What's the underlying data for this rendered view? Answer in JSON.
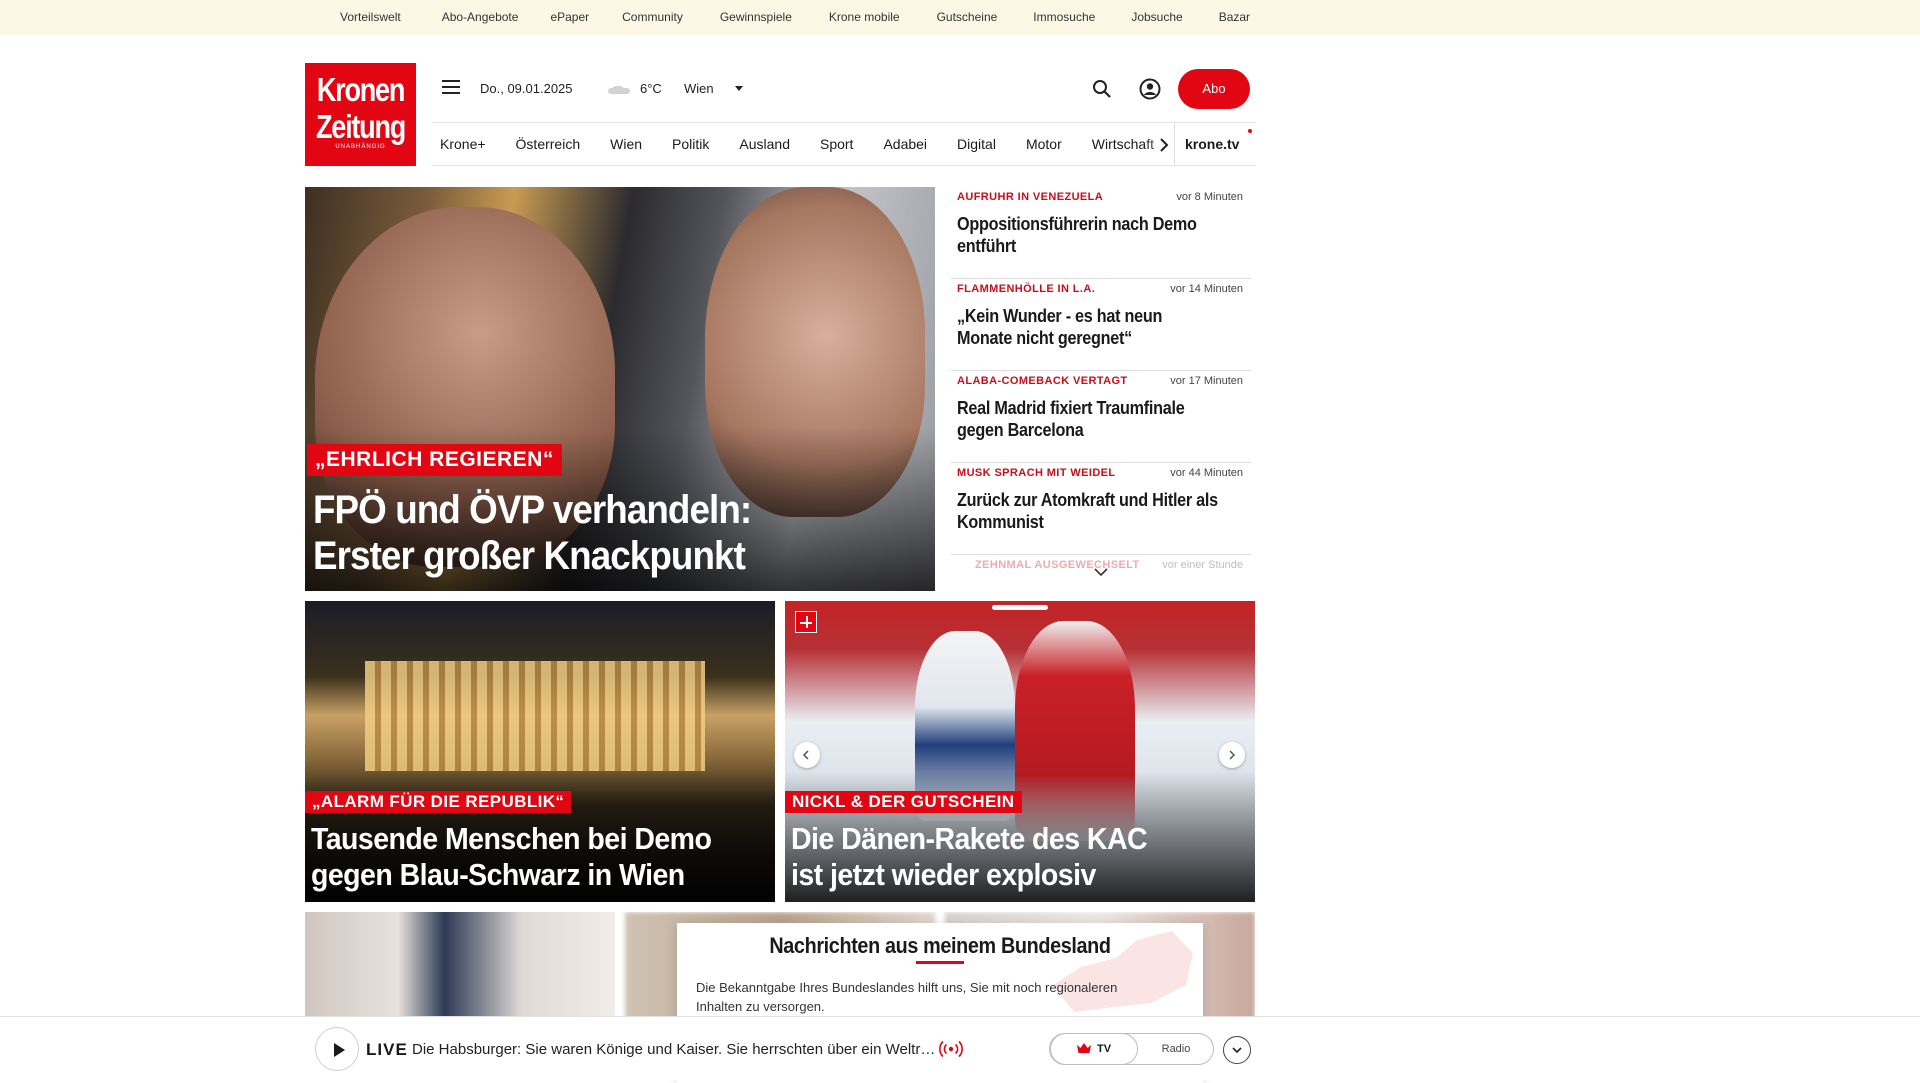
{
  "topbar": {
    "links": [
      "Vorteilswelt",
      "Abo-Angebote",
      "ePaper",
      "Community",
      "Gewinnspiele",
      "Krone mobile",
      "Gutscheine",
      "Immosuche",
      "Jobsuche",
      "Bazar"
    ]
  },
  "logo": {
    "line1": "Kronen",
    "line2": "Zeitung",
    "tagline": "UNABHÄNGIG"
  },
  "header": {
    "date": "Do., 09.01.2025",
    "temperature": "6°C",
    "city": "Wien",
    "abo_label": "Abo",
    "weather_icon": "cloud-icon"
  },
  "nav": {
    "items": [
      "Krone+",
      "Österreich",
      "Wien",
      "Politik",
      "Ausland",
      "Sport",
      "Adabei",
      "Digital",
      "Motor",
      "Wirtschaft"
    ],
    "tv_label": "krone.tv"
  },
  "hero": {
    "kicker": "„EHRLICH REGIEREN“",
    "title_line1": "FPÖ und ÖVP verhandeln:",
    "title_line2": "Erster großer Knackpunkt"
  },
  "ticker": [
    {
      "kicker": "AUFRUHR IN VENEZUELA",
      "time": "vor 8 Minuten",
      "headline": "Oppositionsführerin nach Demo entführt"
    },
    {
      "kicker": "FLAMMENHÖLLE IN L.A.",
      "time": "vor 14 Minuten",
      "headline": "„Kein Wunder - es hat neun Monate nicht geregnet“"
    },
    {
      "kicker": "ALABA-COMEBACK VERTAGT",
      "time": "vor 17 Minuten",
      "headline": "Real Madrid fixiert Traumfinale gegen Barcelona"
    },
    {
      "kicker": "MUSK SPRACH MIT WEIDEL",
      "time": "vor 44 Minuten",
      "headline": "Zurück zur Atomkraft und Hitler als Kommunist"
    },
    {
      "kicker": "ZEHNMAL AUSGEWECHSELT",
      "time": "vor einer Stunde",
      "headline": ""
    }
  ],
  "teasers": [
    {
      "kicker": "„ALARM FÜR DIE REPUBLIK“",
      "title_line1": "Tausende Menschen bei Demo",
      "title_line2": "gegen Blau-Schwarz in Wien"
    },
    {
      "kicker": "NICKL & DER GUTSCHEIN",
      "title_line1": "Die Dänen-Rakete des KAC",
      "title_line2": "ist jetzt wieder explosiv"
    }
  ],
  "modal": {
    "title": "Nachrichten aus meinem Bundesland",
    "text": "Die Bekanntgabe Ihres Bundeslandes hilft uns, Sie mit noch regionaleren Inhalten zu versorgen."
  },
  "player": {
    "live_label": "LIVE",
    "now_playing": "Die Habsburger: Sie waren Könige und Kaiser. Sie herrschten über ein Weltreich",
    "tv_label": "TV",
    "radio_label": "Radio"
  },
  "colors": {
    "brand_red": "#e20613",
    "topbar_bg": "#fdf8e6"
  }
}
